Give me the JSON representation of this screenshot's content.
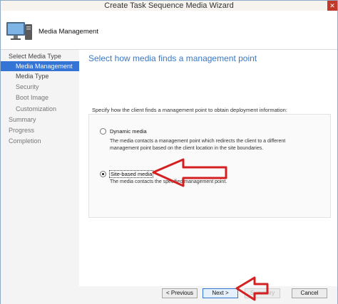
{
  "window": {
    "title": "Create Task Sequence Media Wizard",
    "close_glyph": "✕"
  },
  "header": {
    "title": "Media Management",
    "icon": "computer-wizard-icon"
  },
  "sidebar": {
    "items": [
      {
        "label": "Select Media Type",
        "level": 1,
        "active": false
      },
      {
        "label": "Media Management",
        "level": 2,
        "active": true
      },
      {
        "label": "Media Type",
        "level": 2,
        "active": false
      },
      {
        "label": "Security",
        "level": 2,
        "active": false
      },
      {
        "label": "Boot Image",
        "level": 2,
        "active": false
      },
      {
        "label": "Customization",
        "level": 2,
        "active": false
      },
      {
        "label": "Summary",
        "level": 1,
        "active": false
      },
      {
        "label": "Progress",
        "level": 1,
        "active": false
      },
      {
        "label": "Completion",
        "level": 1,
        "active": false
      }
    ]
  },
  "main": {
    "heading": "Select how media finds a management point",
    "group_label": "Specify how the client finds a management point to obtain deployment information:",
    "options": [
      {
        "label": "Dynamic media",
        "selected": false,
        "description": "The media contacts a management point which redirects the client to a different management point based on the client location in the site boundaries."
      },
      {
        "label": "Site-based media",
        "selected": true,
        "description": "The media contacts the specified management point."
      }
    ]
  },
  "footer": {
    "previous_label": "< Previous",
    "next_label": "Next >",
    "summary_label": "Summary",
    "cancel_label": "Cancel"
  },
  "annotations": {
    "arrow_color": "#d42020"
  }
}
